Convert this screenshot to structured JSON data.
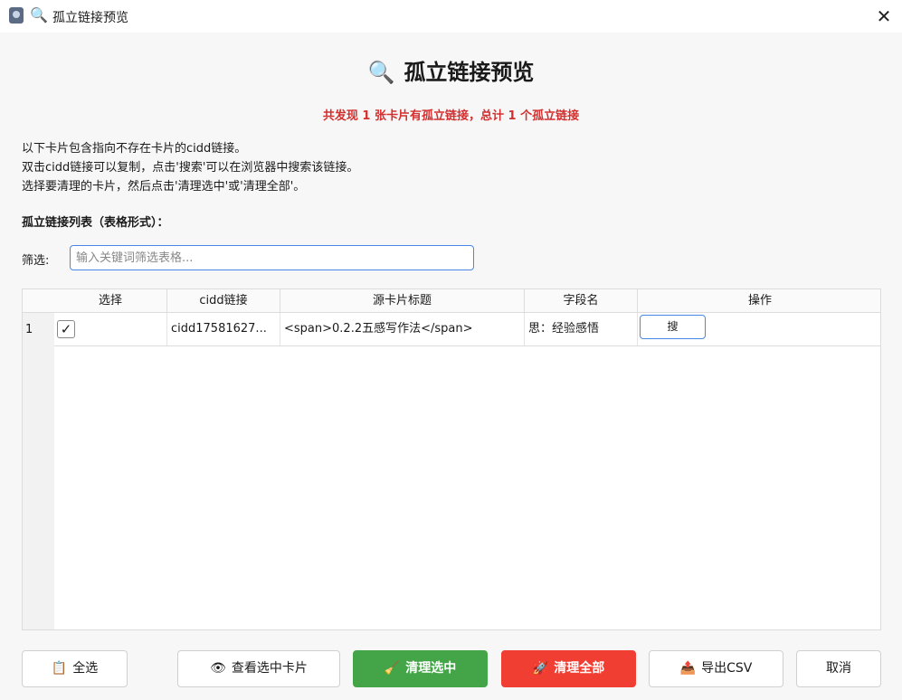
{
  "window": {
    "title": "孤立链接预览",
    "title_icon": "magnifier-icon",
    "close_glyph": "✕"
  },
  "heading": {
    "icon": "🔍",
    "text": "孤立链接预览"
  },
  "summary": "共发现 1 张卡片有孤立链接，总计 1 个孤立链接",
  "description": [
    "以下卡片包含指向不存在卡片的cidd链接。",
    "双击cidd链接可以复制，点击'搜索'可以在浏览器中搜索该链接。",
    "选择要清理的卡片，然后点击'清理选中'或'清理全部'。"
  ],
  "list_label": "孤立链接列表（表格形式）：",
  "filter": {
    "label": "筛选:",
    "placeholder": "输入关键词筛选表格..."
  },
  "table": {
    "columns": [
      "选择",
      "cidd链接",
      "源卡片标题",
      "字段名",
      "操作"
    ],
    "rows": [
      {
        "row_number": "1",
        "selected": true,
        "check_glyph": "✓",
        "cidd": "cidd17581627...",
        "source_title": "<span>0.2.2五感写作法</span>",
        "field": "思：经验感悟",
        "action": "搜"
      }
    ]
  },
  "buttons": {
    "select_all": {
      "icon": "clipboard-icon",
      "glyph": "📋",
      "label": "全选"
    },
    "view_selected": {
      "icon": "eye-icon",
      "glyph": "👁",
      "label": "查看选中卡片"
    },
    "clean_selected": {
      "icon": "broom-icon",
      "glyph": "🧹",
      "label": "清理选中"
    },
    "clean_all": {
      "icon": "rocket-icon",
      "glyph": "🚀",
      "label": "清理全部"
    },
    "export_csv": {
      "icon": "export-icon",
      "glyph": "📤",
      "label": "导出CSV"
    },
    "cancel": {
      "label": "取消"
    }
  },
  "colors": {
    "accent": "#4a86e8",
    "green": "#43a547",
    "red": "#f03e33",
    "summary": "#d32f2f"
  }
}
